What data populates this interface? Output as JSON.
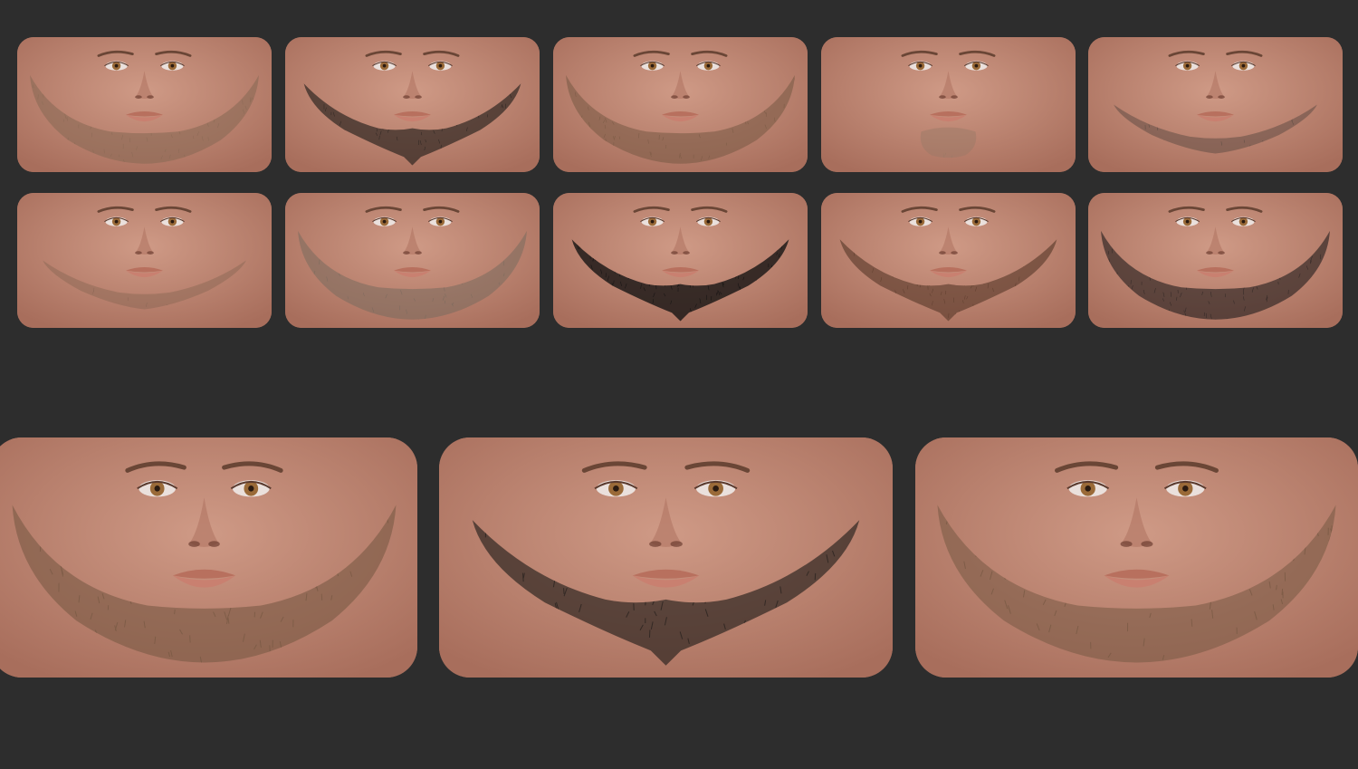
{
  "gallery": {
    "thumbnails": [
      {
        "beard_color": "#8a6a55",
        "style": "full-jaw",
        "density": 0.55
      },
      {
        "beard_color": "#2b2420",
        "style": "pointed-goatee",
        "density": 0.75
      },
      {
        "beard_color": "#7a5a45",
        "style": "full-jaw",
        "density": 0.5
      },
      {
        "beard_color": "#9a7a66",
        "style": "chin-strip",
        "density": 0.3
      },
      {
        "beard_color": "#5a4a42",
        "style": "thin-chinstrap",
        "density": 0.35
      },
      {
        "beard_color": "#8a6655",
        "style": "thin-chinstrap",
        "density": 0.3
      },
      {
        "beard_color": "#7a6a5e",
        "style": "full-jaw",
        "density": 0.45
      },
      {
        "beard_color": "#111111",
        "style": "pointed-goatee",
        "density": 0.95
      },
      {
        "beard_color": "#5e3e2e",
        "style": "pointed-goatee",
        "density": 0.7
      },
      {
        "beard_color": "#2e2624",
        "style": "full-jaw",
        "density": 0.7
      }
    ],
    "previews": [
      {
        "beard_color": "#7a5a45",
        "style": "full-jaw",
        "density": 0.6
      },
      {
        "beard_color": "#2b2420",
        "style": "pointed-goatee",
        "density": 0.75
      },
      {
        "beard_color": "#7a5a45",
        "style": "full-jaw",
        "density": 0.5
      }
    ],
    "colors": {
      "background": "#2d2d2d",
      "skin": "#c08a76",
      "iris": "#9a6a38"
    }
  }
}
